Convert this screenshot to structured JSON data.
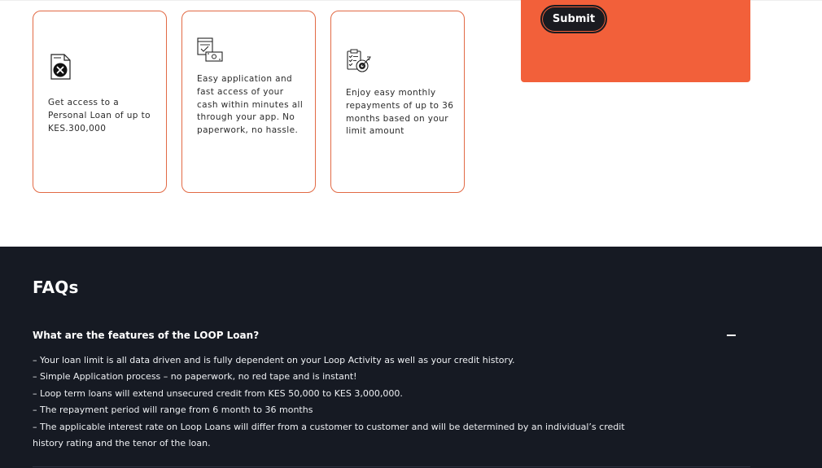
{
  "cards": [
    {
      "icon": "document-x-icon",
      "text": "Get access to a Personal Loan of up to KES.300,000"
    },
    {
      "icon": "app-cash-icon",
      "text": "Easy application and fast access of your cash within minutes all through your app. No paperwork, no hassle."
    },
    {
      "icon": "checklist-target-icon",
      "text": "Enjoy easy monthly repayments of up to 36 months based on your limit amount"
    }
  ],
  "form": {
    "submit_label": "Submit"
  },
  "faq": {
    "title": "FAQs",
    "question": "What are the features of the LOOP Loan?",
    "toggle_icon": "minus-icon",
    "answer_lines": [
      "– Your loan limit is all data driven and is fully dependent on your Loop Activity as well as your credit history.",
      "– Simple Application process – no paperwork, no red tape and is instant!",
      " – Loop term loans will extend unsecured credit from KES 50,000 to KES 3,000,000.",
      " – The repayment period will range from 6 month to 36 months",
      " – The applicable interest rate on Loop Loans will differ from a customer to customer and will be determined by an individual’s credit",
      "history rating and the tenor of the loan."
    ]
  },
  "colors": {
    "accent": "#f2603a",
    "card_border": "#e26a45",
    "dark_bg": "#161a23",
    "button_bg": "#1a1b20"
  }
}
